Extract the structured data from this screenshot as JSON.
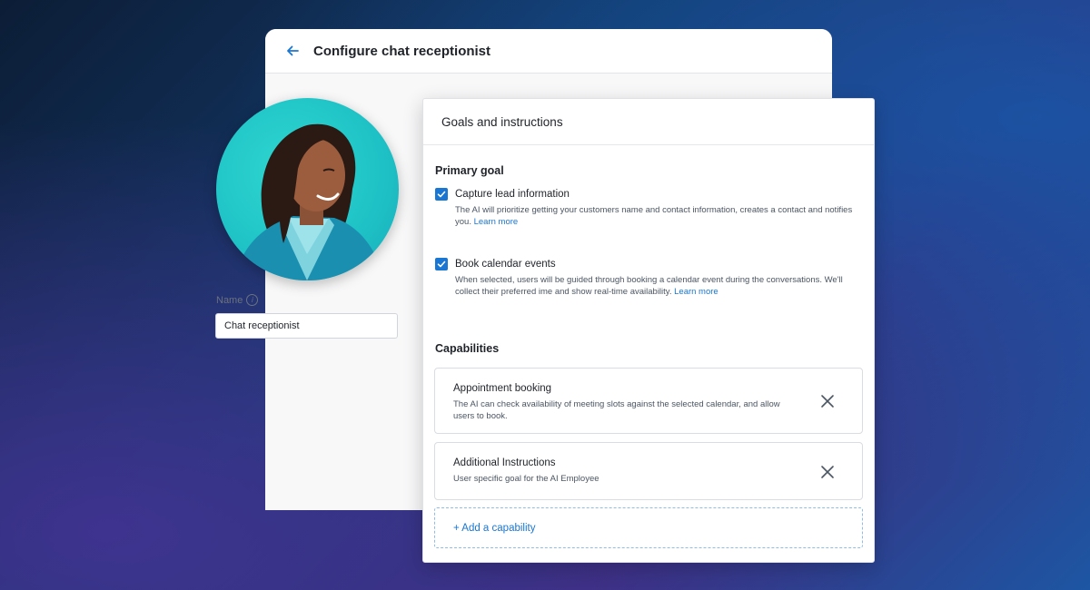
{
  "window": {
    "title": "Configure chat receptionist"
  },
  "profile": {
    "name_label": "Name",
    "name_value": "Chat receptionist"
  },
  "panel": {
    "header": "Goals and instructions",
    "primary_goal_title": "Primary goal",
    "goals": [
      {
        "title": "Capture lead information",
        "description": "The AI will prioritize getting your customers name and contact information, creates a contact and notifies you.",
        "link": "Learn more",
        "checked": true
      },
      {
        "title": "Book calendar events",
        "description": "When selected, users will be guided through booking a calendar event during the conversations. We'll collect their preferred ime and show real-time availability.",
        "link": "Learn more",
        "checked": true
      }
    ],
    "capabilities_title": "Capabilities",
    "capabilities": [
      {
        "title": "Appointment booking",
        "description": "The AI can check availability of meeting slots against the selected calendar, and allow users to book."
      },
      {
        "title": "Additional Instructions",
        "description": "User specific goal for the AI Employee"
      }
    ],
    "add_capability": "+ Add a capability"
  },
  "colors": {
    "accent": "#1976d2",
    "avatar_bg": "#1ec2c6"
  },
  "icons": {
    "back": "arrow-left",
    "close": "x",
    "check": "checkmark",
    "info": "info-circle"
  }
}
